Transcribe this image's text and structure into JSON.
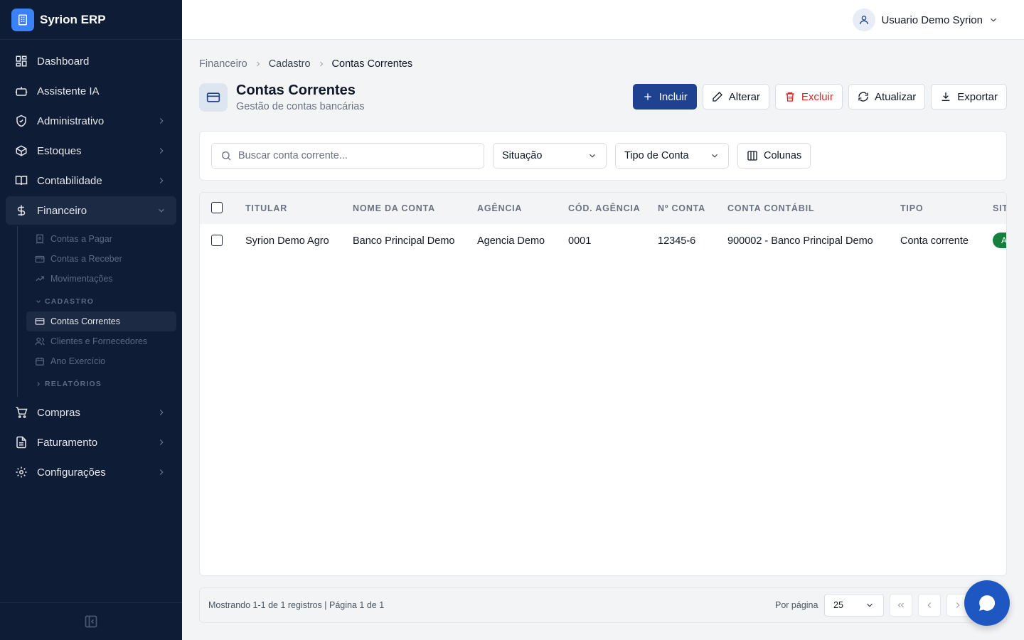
{
  "brand": {
    "name": "Syrion ERP"
  },
  "user": {
    "name": "Usuario Demo Syrion"
  },
  "nav": {
    "dashboard": "Dashboard",
    "assistente": "Assistente IA",
    "administrativo": "Administrativo",
    "estoques": "Estoques",
    "contabilidade": "Contabilidade",
    "financeiro": "Financeiro",
    "compras": "Compras",
    "faturamento": "Faturamento",
    "configuracoes": "Configurações"
  },
  "financeiro_sub": {
    "contas_pagar": "Contas a Pagar",
    "contas_receber": "Contas a Receber",
    "movimentacoes": "Movimentações",
    "section_cadastro": "CADASTRO",
    "contas_correntes": "Contas Correntes",
    "clientes_fornecedores": "Clientes e Fornecedores",
    "ano_exercicio": "Ano Exercício",
    "section_relatorios": "RELATÓRIOS"
  },
  "breadcrumb": [
    "Financeiro",
    "Cadastro",
    "Contas Correntes"
  ],
  "page": {
    "title": "Contas Correntes",
    "subtitle": "Gestão de contas bancárias"
  },
  "actions": {
    "incluir": "Incluir",
    "alterar": "Alterar",
    "excluir": "Excluir",
    "atualizar": "Atualizar",
    "exportar": "Exportar"
  },
  "filters": {
    "search_placeholder": "Buscar conta corrente...",
    "situacao": "Situação",
    "tipo_conta": "Tipo de Conta",
    "colunas": "Colunas"
  },
  "table": {
    "headers": [
      "TITULAR",
      "NOME DA CONTA",
      "AGÊNCIA",
      "CÓD. AGÊNCIA",
      "Nº CONTA",
      "CONTA CONTÁBIL",
      "TIPO",
      "SIT"
    ],
    "rows": [
      {
        "titular": "Syrion Demo Agro",
        "nome": "Banco Principal Demo",
        "agencia": "Agencia Demo",
        "cod_agencia": "0001",
        "numero": "12345-6",
        "conta_contabil": "900002 - Banco Principal Demo",
        "tipo": "Conta corrente",
        "situacao": "A"
      }
    ]
  },
  "pager": {
    "info": "Mostrando 1-1 de 1 registros | Página 1 de 1",
    "per_page_label": "Por página",
    "per_page_value": "25"
  },
  "colors": {
    "sidebar": "#0f1c35",
    "primary": "#1e4190",
    "danger": "#dc2626",
    "success": "#15803d",
    "fab": "#1e56c2"
  }
}
